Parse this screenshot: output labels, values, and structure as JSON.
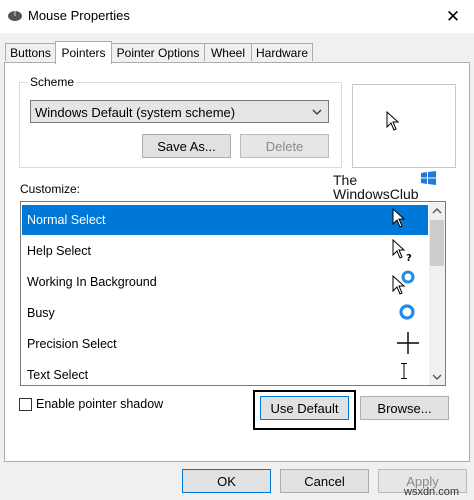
{
  "window": {
    "title": "Mouse Properties",
    "close_glyph": "✕"
  },
  "tabs": [
    {
      "label": "Buttons"
    },
    {
      "label": "Pointers"
    },
    {
      "label": "Pointer Options"
    },
    {
      "label": "Wheel"
    },
    {
      "label": "Hardware"
    }
  ],
  "scheme": {
    "label": "Scheme",
    "selected": "Windows Default (system scheme)",
    "save_as_label": "Save As...",
    "delete_label": "Delete"
  },
  "watermark": {
    "line1": "The",
    "line2": "WindowsClub"
  },
  "customize": {
    "label": "Customize:",
    "items": [
      {
        "label": "Normal Select",
        "icon": "arrow-cursor-icon",
        "selected": true
      },
      {
        "label": "Help Select",
        "icon": "help-cursor-icon"
      },
      {
        "label": "Working In Background",
        "icon": "working-cursor-icon"
      },
      {
        "label": "Busy",
        "icon": "busy-cursor-icon"
      },
      {
        "label": "Precision Select",
        "icon": "crosshair-cursor-icon"
      },
      {
        "label": "Text Select",
        "icon": "text-beam-cursor-icon"
      }
    ]
  },
  "options": {
    "pointer_shadow_label": "Enable pointer shadow",
    "pointer_shadow_checked": false,
    "use_default_label": "Use Default",
    "browse_label": "Browse..."
  },
  "footer": {
    "ok_label": "OK",
    "cancel_label": "Cancel",
    "apply_label": "Apply"
  },
  "site": "wsxdn.com",
  "colors": {
    "selection": "#0078d7",
    "accent_border": "#0078d7",
    "watermark_blue": "#1e7bd6"
  }
}
